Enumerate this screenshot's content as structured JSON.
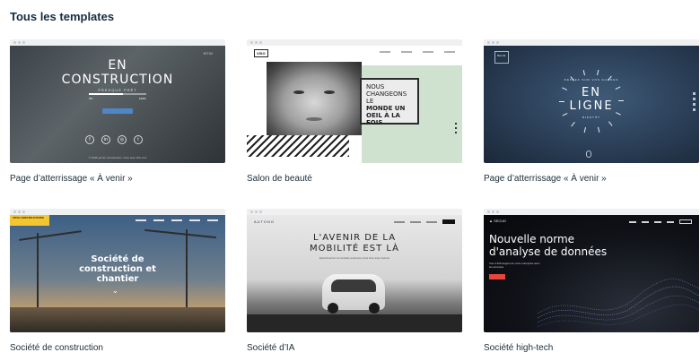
{
  "page": {
    "title": "Tous les templates"
  },
  "cards": [
    {
      "caption": "Page d’atterrissage « À venir »",
      "preview": {
        "logo": "SITIO",
        "heading": "EN\nCONSTRUCTION",
        "subheading": "PRESQUE PRÊT",
        "progress_left": "0%",
        "progress_right": "100%",
        "progress": 0.6,
        "button_color": "#4f86c6",
        "socials": [
          "f",
          "in",
          "◎",
          "t"
        ],
        "footer": "© 2035 par En Construction. Créé avec Wix.com"
      }
    },
    {
      "caption": "Salon de beauté",
      "preview": {
        "brand": "VISO",
        "heading_light": "NOUS CHANGEONS LE",
        "heading_bold": "MONDE UN OEIL À LA FOIS",
        "accent_color": "#cfe2cf"
      }
    },
    {
      "caption": "Page d’atterrissage « À venir »",
      "preview": {
        "logo": "Bientôt",
        "arc_text": "RESTEZ SUR VOS GARDES",
        "heading": "EN\nLIGNE",
        "subheading": "BIENTÔT"
      }
    },
    {
      "caption": "Société de construction",
      "preview": {
        "badge": "SITIO CONSTRUCTIONS",
        "badge_color": "#f2c531",
        "heading": "Société de\nconstruction et\nchantier"
      }
    },
    {
      "caption": "Société d’IA",
      "preview": {
        "logo": "AUTONO",
        "heading": "L'AVENIR DE LA\nMOBILITÉ EST LÀ",
        "subheading": "Expérimentez la conduite autonome plus sûre avec Autono"
      }
    },
    {
      "caption": "Société high-tech",
      "preview": {
        "logo": "▲ SECUD",
        "heading": "Nouvelle norme\nd'analyse de données",
        "subheading": "Vue à 360 degrés de votre entreprise avec les données",
        "button_color": "#e6453b"
      }
    }
  ]
}
